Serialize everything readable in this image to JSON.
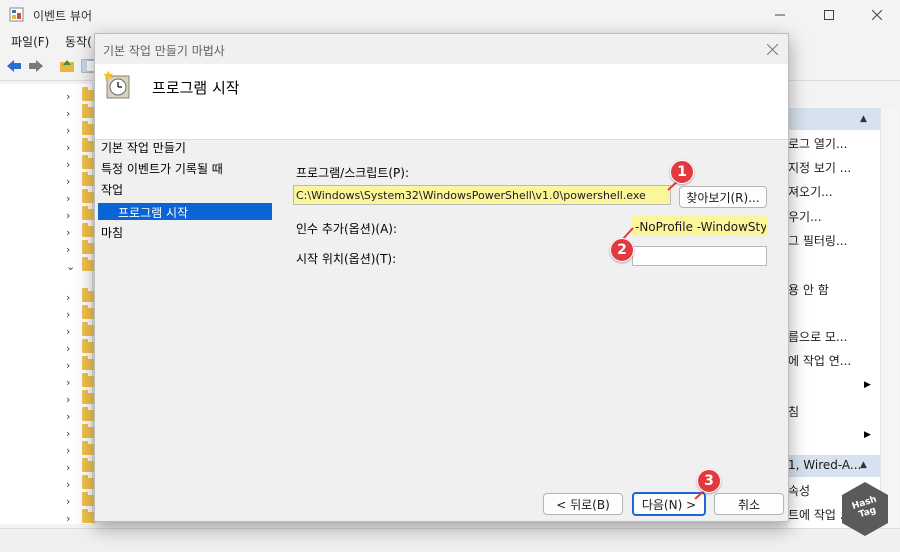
{
  "main_window": {
    "title": "이벤트 뷰어",
    "menu": {
      "file": "파일(F)",
      "action": "동작("
    }
  },
  "actions_pane": {
    "items": [
      "로그 열기...",
      "지정 보기 ...",
      "져오기...",
      "우기...",
      "그 필터링...",
      "용 안 함",
      "름으로 모...",
      "에 작업 연...",
      "침",
      "1, Wired-A...",
      "속성",
      "트에 작업 ..."
    ]
  },
  "wizard": {
    "title": "기본 작업 만들기 마법사",
    "heading": "프로그램 시작",
    "steps": {
      "create_basic_task": "기본 작업 만들기",
      "event_logged": "특정 이벤트가 기록될 때",
      "action": "작업",
      "start_program": "프로그램 시작",
      "finish": "마침"
    },
    "program_label": "프로그램/스크립트(P):",
    "program_value": "C:\\Windows\\System32\\WindowsPowerShell\\v1.0\\powershell.exe",
    "browse_button": "찾아보기(R)...",
    "args_label": "인수 추가(옵션)(A):",
    "args_value": "-NoProfile -WindowStyl",
    "start_in_label": "시작 위치(옵션)(T):",
    "start_in_value": "",
    "back_button": "< 뒤로(B)",
    "next_button": "다음(N) >",
    "cancel_button": "취소"
  },
  "badges": [
    "1",
    "2",
    "3"
  ],
  "watermark": {
    "line1": "Hash",
    "line2": "Tag"
  },
  "colors": {
    "selection": "#0a64d6",
    "highlight": "#fbf59b",
    "badge": "#e2393e",
    "next_border": "#1e67d0",
    "action_header": "#d6e2f0"
  }
}
